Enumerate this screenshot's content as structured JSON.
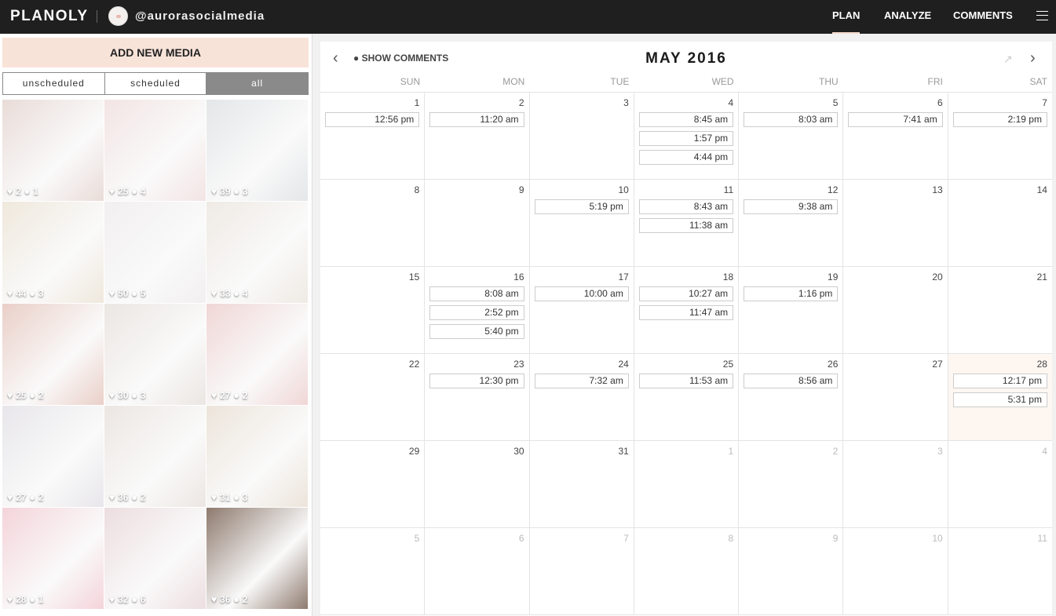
{
  "header": {
    "logo": "PLANOLY",
    "handle": "@aurorasocialmedia",
    "nav": [
      "PLAN",
      "ANALYZE",
      "COMMENTS"
    ]
  },
  "sidebar": {
    "add_label": "ADD NEW MEDIA",
    "tabs": [
      "unscheduled",
      "scheduled",
      "all"
    ],
    "active_tab": "all",
    "media": [
      {
        "likes": "2",
        "comments": "1",
        "color": "#e9dcd8"
      },
      {
        "likes": "25",
        "comments": "4",
        "color": "#f3e4e4"
      },
      {
        "likes": "39",
        "comments": "3",
        "color": "#e4e6e8"
      },
      {
        "likes": "44",
        "comments": "3",
        "color": "#efe8dc"
      },
      {
        "likes": "50",
        "comments": "5",
        "color": "#f2eff0"
      },
      {
        "likes": "33",
        "comments": "4",
        "color": "#efeae4"
      },
      {
        "likes": "25",
        "comments": "2",
        "color": "#eacfc8"
      },
      {
        "likes": "30",
        "comments": "3",
        "color": "#ebe6e2"
      },
      {
        "likes": "27",
        "comments": "2",
        "color": "#f0d6d6"
      },
      {
        "likes": "27",
        "comments": "2",
        "color": "#e8e6ea"
      },
      {
        "likes": "36",
        "comments": "2",
        "color": "#ece6e2"
      },
      {
        "likes": "31",
        "comments": "3",
        "color": "#ece4da"
      },
      {
        "likes": "28",
        "comments": "1",
        "color": "#f4d4da"
      },
      {
        "likes": "32",
        "comments": "6",
        "color": "#ecdde0"
      },
      {
        "likes": "36",
        "comments": "2",
        "color": "#8e7a6e"
      }
    ]
  },
  "calendar": {
    "show_comments": "SHOW COMMENTS",
    "month": "MAY 2016",
    "weekdays": [
      "SUN",
      "MON",
      "TUE",
      "WED",
      "THU",
      "FRI",
      "SAT"
    ],
    "weeks": [
      [
        {
          "d": "1",
          "t": [
            "12:56 pm"
          ]
        },
        {
          "d": "2",
          "t": [
            "11:20 am"
          ]
        },
        {
          "d": "3",
          "t": []
        },
        {
          "d": "4",
          "t": [
            "8:45 am",
            "1:57 pm",
            "4:44 pm"
          ]
        },
        {
          "d": "5",
          "t": [
            "8:03 am"
          ]
        },
        {
          "d": "6",
          "t": [
            "7:41 am"
          ]
        },
        {
          "d": "7",
          "t": [
            "2:19 pm"
          ]
        }
      ],
      [
        {
          "d": "8",
          "t": []
        },
        {
          "d": "9",
          "t": []
        },
        {
          "d": "10",
          "t": [
            "5:19 pm"
          ]
        },
        {
          "d": "11",
          "t": [
            "8:43 am",
            "11:38 am"
          ]
        },
        {
          "d": "12",
          "t": [
            "9:38 am"
          ]
        },
        {
          "d": "13",
          "t": []
        },
        {
          "d": "14",
          "t": []
        }
      ],
      [
        {
          "d": "15",
          "t": []
        },
        {
          "d": "16",
          "t": [
            "8:08 am",
            "2:52 pm",
            "5:40 pm"
          ]
        },
        {
          "d": "17",
          "t": [
            "10:00 am"
          ]
        },
        {
          "d": "18",
          "t": [
            "10:27 am",
            "11:47 am"
          ]
        },
        {
          "d": "19",
          "t": [
            "1:16 pm"
          ]
        },
        {
          "d": "20",
          "t": []
        },
        {
          "d": "21",
          "t": []
        }
      ],
      [
        {
          "d": "22",
          "t": []
        },
        {
          "d": "23",
          "t": [
            "12:30 pm"
          ]
        },
        {
          "d": "24",
          "t": [
            "7:32 am"
          ]
        },
        {
          "d": "25",
          "t": [
            "11:53 am"
          ]
        },
        {
          "d": "26",
          "t": [
            "8:56 am"
          ]
        },
        {
          "d": "27",
          "t": []
        },
        {
          "d": "28",
          "t": [
            "12:17 pm",
            "5:31 pm"
          ],
          "today": true
        }
      ],
      [
        {
          "d": "29",
          "t": []
        },
        {
          "d": "30",
          "t": []
        },
        {
          "d": "31",
          "t": []
        },
        {
          "d": "1",
          "t": [],
          "muted": true
        },
        {
          "d": "2",
          "t": [],
          "muted": true
        },
        {
          "d": "3",
          "t": [],
          "muted": true
        },
        {
          "d": "4",
          "t": [],
          "muted": true
        }
      ],
      [
        {
          "d": "5",
          "t": [],
          "muted": true
        },
        {
          "d": "6",
          "t": [],
          "muted": true
        },
        {
          "d": "7",
          "t": [],
          "muted": true
        },
        {
          "d": "8",
          "t": [],
          "muted": true
        },
        {
          "d": "9",
          "t": [],
          "muted": true
        },
        {
          "d": "10",
          "t": [],
          "muted": true
        },
        {
          "d": "11",
          "t": [],
          "muted": true
        }
      ]
    ]
  }
}
